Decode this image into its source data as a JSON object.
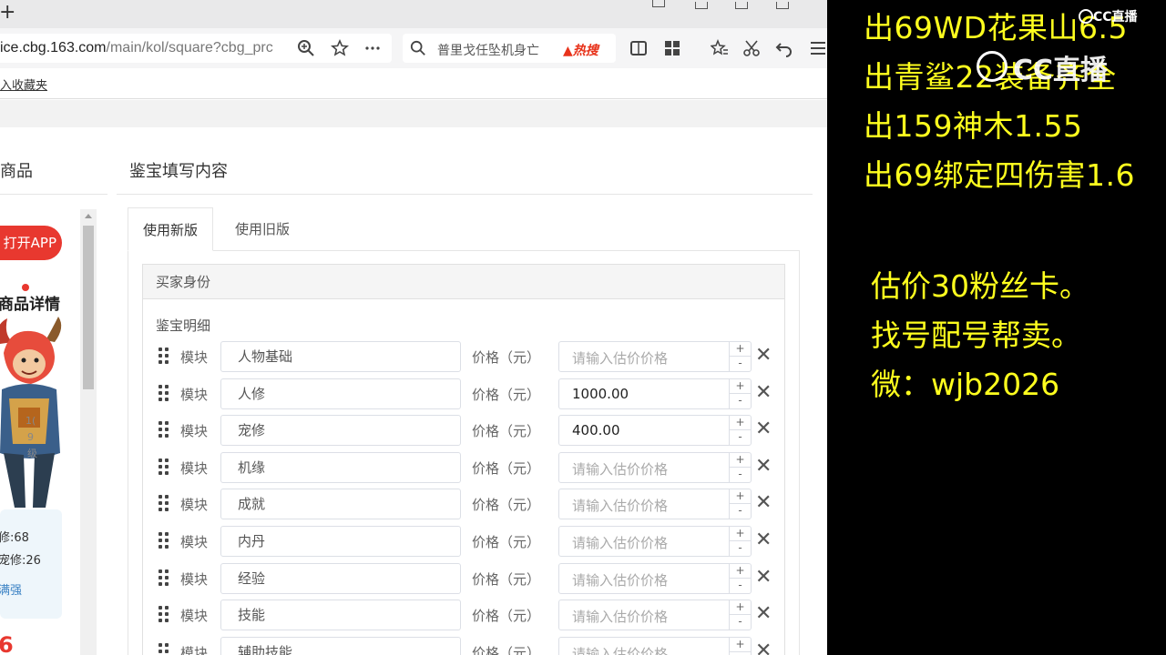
{
  "browser": {
    "url_host": "ice.cbg.163.com",
    "url_path": "/main/kol/square?cbg_prc",
    "search_query": "普里戈任坠机身亡",
    "search_hot": "热搜",
    "bookmark_text": "入收藏夹"
  },
  "left_panel": {
    "title": "商品",
    "open_app": "打开APP",
    "detail_title": "商品详情",
    "stat_1": "修:68",
    "stat_2": "宠修:26",
    "more_link": "满强",
    "price": "6"
  },
  "form": {
    "title": "鉴宝填写内容",
    "tabs": [
      {
        "label": "使用新版",
        "active": true
      },
      {
        "label": "使用旧版",
        "active": false
      }
    ],
    "section_head": "买家身份",
    "section_sub": "鉴宝明细",
    "module_label": "模块",
    "price_label": "价格（元）",
    "placeholder": "请输入估价价格",
    "rows": [
      {
        "name": "人物基础",
        "value": ""
      },
      {
        "name": "人修",
        "value": "1000.00"
      },
      {
        "name": "宠修",
        "value": "400.00"
      },
      {
        "name": "机缘",
        "value": ""
      },
      {
        "name": "成就",
        "value": ""
      },
      {
        "name": "内丹",
        "value": ""
      },
      {
        "name": "经验",
        "value": ""
      },
      {
        "name": "技能",
        "value": ""
      },
      {
        "name": "辅助技能",
        "value": ""
      }
    ]
  },
  "overlay": {
    "color": "#ffff1e",
    "lines_top": [
      "出69WD花果山6.5",
      "出青鲨22装备齐全",
      "出159神木1.55",
      "出69绑定四伤害1.6"
    ],
    "lines_bottom": [
      "估价30粉丝卡。",
      "找号配号帮卖。",
      "微：wjb2026"
    ],
    "watermark": "CC直播"
  }
}
